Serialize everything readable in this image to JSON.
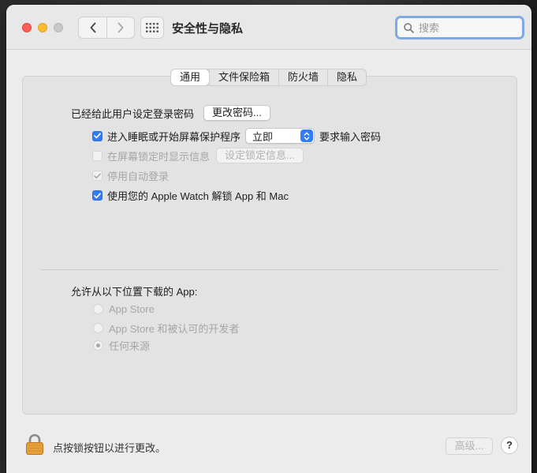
{
  "window": {
    "title": "安全性与隐私",
    "search_placeholder": "搜索"
  },
  "tabs": [
    {
      "label": "通用",
      "active": true
    },
    {
      "label": "文件保险箱",
      "active": false
    },
    {
      "label": "防火墙",
      "active": false
    },
    {
      "label": "隐私",
      "active": false
    }
  ],
  "general": {
    "password_set_label": "已经给此用户设定登录密码",
    "change_password_button": "更改密码...",
    "require_password": {
      "checked": true,
      "prefix": "进入睡眠或开始屏幕保护程序",
      "delay_value": "立即",
      "suffix": "要求输入密码"
    },
    "show_message": {
      "checked": false,
      "enabled": false,
      "label": "在屏幕锁定时显示信息",
      "button": "设定锁定信息..."
    },
    "disable_auto_login": {
      "checked": true,
      "enabled": false,
      "label": "停用自动登录"
    },
    "apple_watch_unlock": {
      "checked": true,
      "label": "使用您的 Apple Watch 解锁 App 和 Mac"
    }
  },
  "downloads": {
    "heading": "允许从以下位置下载的 App:",
    "options": [
      {
        "label": "App Store",
        "selected": false
      },
      {
        "label": "App Store 和被认可的开发者",
        "selected": false
      },
      {
        "label": "任何来源",
        "selected": true
      }
    ]
  },
  "footer": {
    "lock_text": "点按锁按钮以进行更改。",
    "advanced_button": "高级...",
    "help_button": "?"
  },
  "colors": {
    "accent": "#2f7cf6",
    "search_focus": "#7fa9e5",
    "lock": "#e8a03a"
  },
  "icons": [
    "back-chevron-icon",
    "forward-chevron-icon",
    "grid-icon",
    "search-icon",
    "checkmark-icon",
    "popup-arrows-icon",
    "lock-icon"
  ]
}
